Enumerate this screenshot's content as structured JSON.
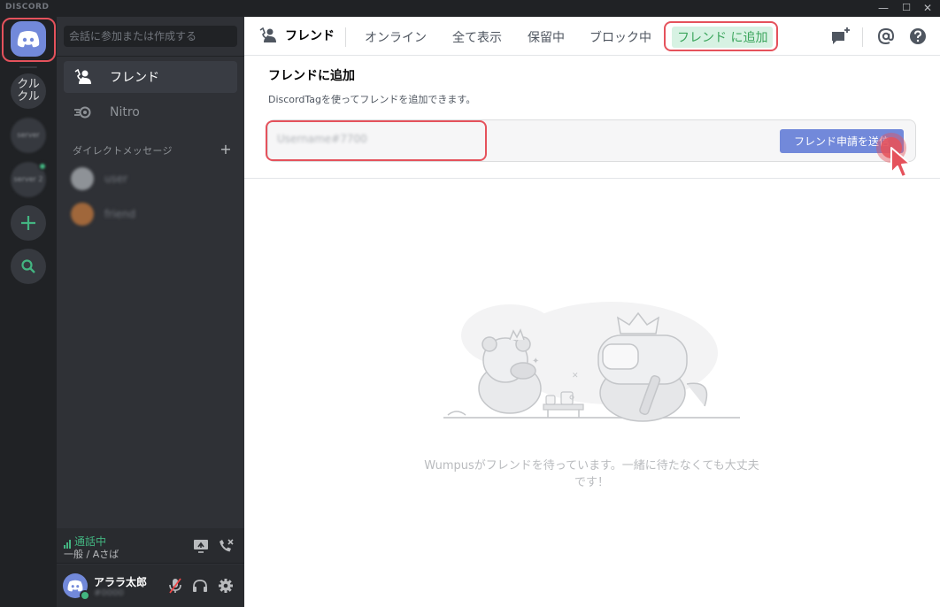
{
  "titlebar": {
    "brand": "DISCORD",
    "minimize": "—",
    "maximize": "☐",
    "close": "✕"
  },
  "servers": [
    {
      "label": "クルクル"
    },
    {
      "label": "server"
    },
    {
      "label": "server 2"
    }
  ],
  "sidebar": {
    "search_placeholder": "会話に参加または作成する",
    "items": [
      {
        "label": "フレンド",
        "icon": "friends-icon"
      },
      {
        "label": "Nitro",
        "icon": "nitro-icon"
      }
    ],
    "dm_header": "ダイレクトメッセージ",
    "dm_add": "+",
    "dms": [
      {
        "name": "user",
        "color": "#8e9297"
      },
      {
        "name": "friend",
        "color": "#a0673b"
      }
    ]
  },
  "voice": {
    "status": "通話中",
    "channel": "一般 / Aさば"
  },
  "user": {
    "name": "アララ太郎",
    "tag": "#0000"
  },
  "topbar": {
    "title": "フレンド",
    "tabs": [
      "オンライン",
      "全て表示",
      "保留中",
      "ブロック中"
    ],
    "add_friend_tab": "フレンド に追加"
  },
  "add_friend": {
    "title": "フレンドに追加",
    "description": "DiscordTagを使ってフレンドを追加できます。",
    "input_value": "Username#7700",
    "send_button": "フレンド申請を送信"
  },
  "empty": {
    "text": "Wumpusがフレンドを待っています。一緒に待たなくても大丈夫です！"
  },
  "colors": {
    "accent": "#7289da",
    "online": "#43b581",
    "highlight": "#e5525c"
  }
}
